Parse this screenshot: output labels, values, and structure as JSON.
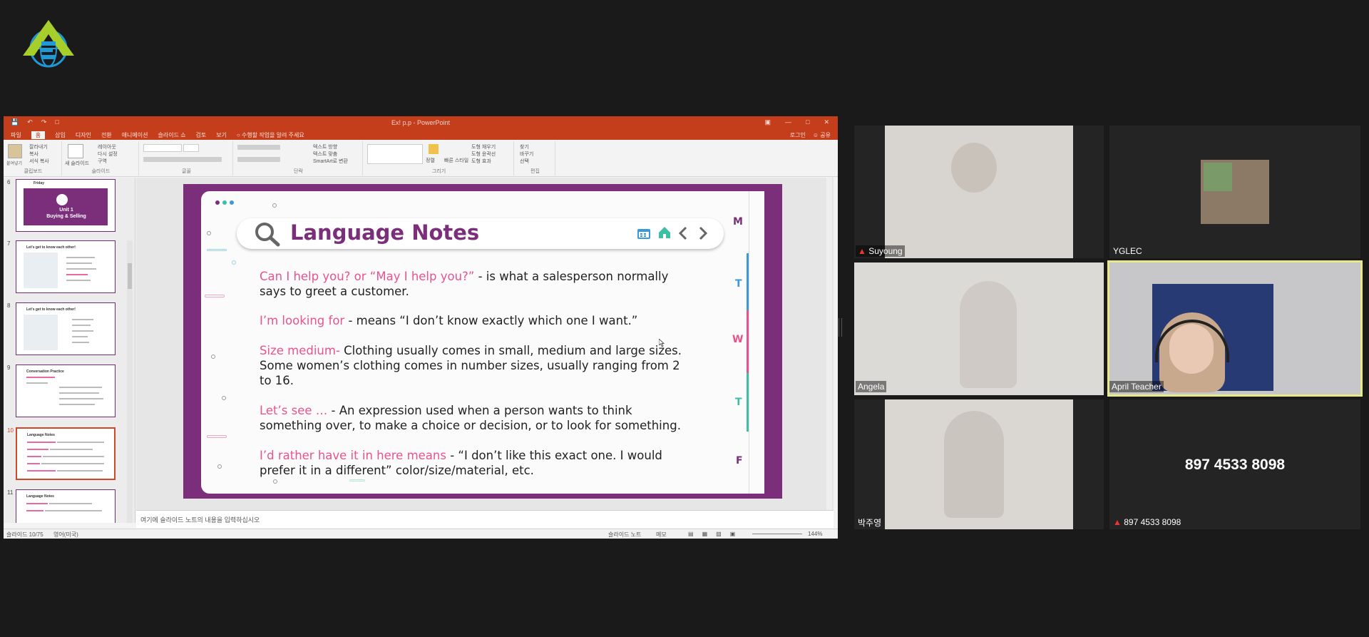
{
  "app": {
    "window_title": "Ex! p.p - PowerPoint",
    "menu_tabs": [
      "파일",
      "홈",
      "삽입",
      "디자인",
      "전환",
      "애니메이션",
      "슬라이드 쇼",
      "검토",
      "보기"
    ],
    "tell_me": "수행할 작업을 알려 주세요",
    "signin": "로그인",
    "share": "공유",
    "ribbon_groups": [
      "클립보드",
      "슬라이드",
      "글꼴",
      "단락",
      "그리기",
      "편집"
    ],
    "ribbon_labels": {
      "paste": "붙여넣기",
      "cut": "잘라내기",
      "copy": "복사",
      "format_painter": "서식 복사",
      "new_slide": "새 슬라이드",
      "layout": "레이아웃",
      "reset": "다시 설정",
      "section": "구역",
      "text_dir": "텍스트 방향",
      "text_align": "텍스트 맞춤",
      "smartart": "SmartArt로 변환",
      "arrange": "정렬",
      "quick_styles": "빠른 스타일",
      "shape_fill": "도형 채우기",
      "shape_outline": "도형 윤곽선",
      "shape_effects": "도형 효과",
      "find": "찾기",
      "replace": "바꾸기",
      "select": "선택"
    },
    "notes_placeholder": "여기에 슬라이드 노트의 내용을 입력하십시오",
    "status_slide": "슬라이드 10/75",
    "status_lang": "영어(미국)",
    "status_notes": "슬라이드 노트",
    "status_comments": "메모",
    "zoom": "144%"
  },
  "thumbnails": [
    {
      "num": "6",
      "title": "Friday",
      "subtitle": "Unit 1\nBuying & Selling",
      "kind": "cover"
    },
    {
      "num": "7",
      "title": "Let's get to know each other!",
      "kind": "list"
    },
    {
      "num": "8",
      "title": "Let's get to know each other!",
      "kind": "list"
    },
    {
      "num": "9",
      "title": "Conversation Practice",
      "kind": "list"
    },
    {
      "num": "10",
      "title": "Language Notes",
      "kind": "text",
      "selected": true
    },
    {
      "num": "11",
      "title": "Language Notes",
      "kind": "text"
    }
  ],
  "slide": {
    "title": "Language Notes",
    "days": [
      "M",
      "T",
      "W",
      "T",
      "F"
    ],
    "day_colors": [
      "#7b2f7b",
      "#3a9ad9",
      "#e9538d",
      "#3cbfa4",
      "#7b2f7b"
    ],
    "notes": [
      {
        "term": "Can I help you? or “May I help you?”",
        "rest": " - is what a salesperson normally says to greet a customer."
      },
      {
        "term": " I’m looking for",
        "rest": " - means “I don’t know exactly which one I want.”"
      },
      {
        "term": "Size medium-",
        "rest": " Clothing usually comes in small, medium and large sizes. Some women’s clothing comes in number sizes, usually ranging from 2 to 16."
      },
      {
        "term": " Let’s see …",
        "rest": " - An expression used when a person wants to think something over, to make a choice or decision, or to look for something."
      },
      {
        "term": " I’d rather have it in here means",
        "rest": " -  “I don’t like this exact one. I would prefer it in a different” color/size/material, etc."
      }
    ]
  },
  "participants": [
    {
      "name": "Suyoung",
      "muted": true
    },
    {
      "name": "YGLEC",
      "muted": false
    },
    {
      "name": "Angela",
      "muted": false
    },
    {
      "name": "April Teacher",
      "muted": false,
      "active": true
    },
    {
      "name": "박주영",
      "muted": false
    },
    {
      "name": "897 4533 8098",
      "muted": true,
      "phone": "897 4533 8098"
    }
  ]
}
